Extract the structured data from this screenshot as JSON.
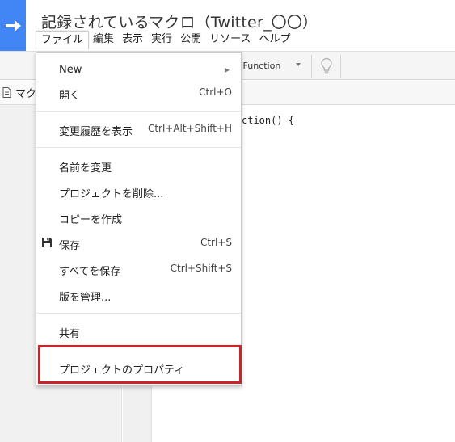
{
  "header": {
    "title": "記録されているマクロ（Twitter_〇〇）"
  },
  "menubar": {
    "items": [
      "ファイル",
      "編集",
      "表示",
      "実行",
      "公開",
      "リソース",
      "ヘルプ"
    ]
  },
  "toolbar": {
    "function_select": "yFunction"
  },
  "file_panel": {
    "tab_label": "マク"
  },
  "editor": {
    "code": "ction() {"
  },
  "file_menu": {
    "new_label": "New",
    "open_label": "開く",
    "open_shortcut": "Ctrl+O",
    "history_label": "変更履歴を表示",
    "history_shortcut": "Ctrl+Alt+Shift+H",
    "rename_label": "名前を変更",
    "delete_label": "プロジェクトを削除...",
    "copy_label": "コピーを作成",
    "save_label": "保存",
    "save_shortcut": "Ctrl+S",
    "save_all_label": "すべてを保存",
    "save_all_shortcut": "Ctrl+Shift+S",
    "versions_label": "版を管理...",
    "share_label": "共有",
    "properties_label": "プロジェクトのプロパティ"
  },
  "colors": {
    "logo": "#4285f4",
    "highlight": "#cc2229"
  },
  "icons": [
    "arrow-right-icon",
    "chevron-down-icon",
    "lightbulb-icon",
    "document-icon",
    "floppy-disk-icon",
    "submenu-arrow-icon"
  ]
}
